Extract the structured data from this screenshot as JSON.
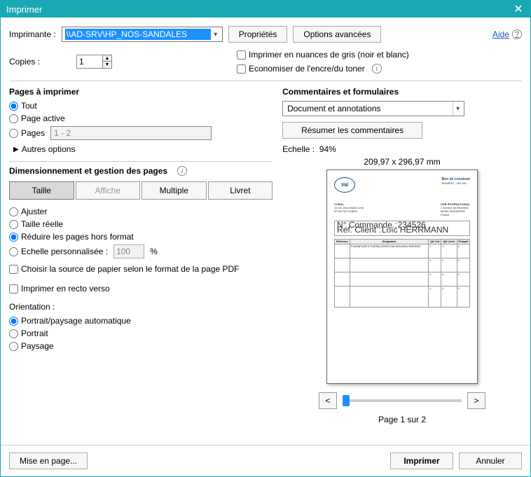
{
  "window": {
    "title": "Imprimer"
  },
  "help": {
    "label": "Aide"
  },
  "printer": {
    "label": "Imprimante :",
    "selected": "\\\\AD-SRV\\HP_NOS-SANDALES",
    "properties_btn": "Propriétés",
    "advanced_btn": "Options avancées"
  },
  "copies": {
    "label": "Copies :",
    "value": "1"
  },
  "options": {
    "grayscale": "Imprimer en nuances de gris (noir et blanc)",
    "save_ink": "Economiser de l'encre/du toner"
  },
  "pages_section": {
    "title": "Pages à imprimer",
    "all": "Tout",
    "active": "Page active",
    "pages": "Pages",
    "range": "1 - 2",
    "more": "Autres options"
  },
  "sizing": {
    "title": "Dimensionnement et gestion des pages",
    "tabs": {
      "size": "Taille",
      "poster": "Affiche",
      "multiple": "Multiple",
      "booklet": "Livret"
    },
    "fit": "Ajuster",
    "actual": "Taille réelle",
    "shrink": "Réduire les pages hors format",
    "custom": "Echelle personnalisée :",
    "custom_value": "100",
    "custom_unit": "%",
    "paper_source": "Choisir la source de papier selon le format de la page PDF",
    "duplex": "Imprimer en recto verso"
  },
  "orientation": {
    "label": "Orientation :",
    "auto": "Portrait/paysage automatique",
    "portrait": "Portrait",
    "landscape": "Paysage"
  },
  "comments": {
    "title": "Commentaires et formulaires",
    "selected": "Document et annotations",
    "summarize_btn": "Résumer les commentaires"
  },
  "preview": {
    "scale_label": "Echelle :",
    "scale_value": "94%",
    "dimensions": "209,97 x 296,97 mm",
    "page_info": "Page 1 sur 2",
    "prev": "<",
    "next": ">",
    "doc": {
      "logo": "Val",
      "bon": "Bon de Livraison",
      "numero": "NUMERO : 004 951",
      "company1": "YOBAL",
      "addr1a": "11 rue Jean-Marie Lehn",
      "addr1b": "67140 NIS SHEIM",
      "company2": "OSB INTERNATIONAL",
      "addr2a": "7 Avenue de Bruxelles",
      "addr2b": "68350 DIDENHEIM",
      "country": "France",
      "cmd_label": "N° Commande :",
      "cmd": "234526",
      "ref_label": "Réf. Client :",
      "ref": "Loïc HERRMANN",
      "col1": "Référence",
      "col2": "Désignation",
      "col3": "Qté Cde",
      "col4": "Qté Livrée",
      "col5": "Reliquat"
    }
  },
  "footer": {
    "page_setup": "Mise en page...",
    "print": "Imprimer",
    "cancel": "Annuler"
  }
}
